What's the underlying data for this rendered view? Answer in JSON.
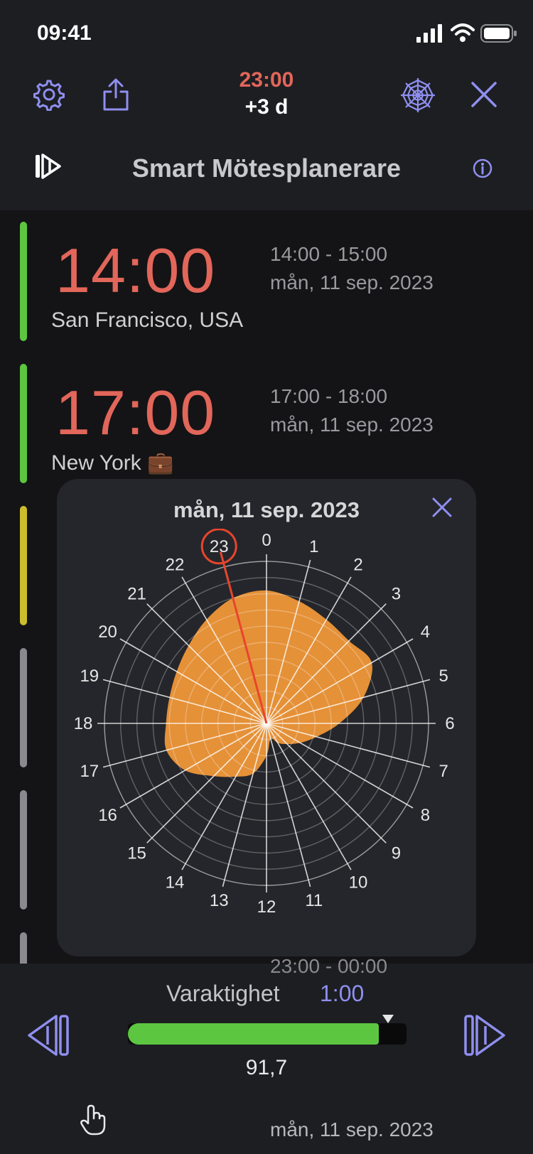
{
  "status": {
    "time": "09:41"
  },
  "toolbar": {
    "center_time": "23:00",
    "day_offset": "+3 d",
    "title": "Smart Mötesplanerare"
  },
  "cards": [
    {
      "time": "14:00",
      "city": "San Francisco, USA",
      "range": "14:00 - 15:00",
      "date": "mån, 11 sep. 2023",
      "bar_color": "#5dc640"
    },
    {
      "time": "17:00",
      "city": "New York 💼",
      "range": "17:00 - 18:00",
      "date": "mån, 11 sep. 2023",
      "bar_color": "#5dc640"
    }
  ],
  "partial_card": {
    "range": "23:00 - 00:00",
    "date": "mån, 11 sep. 2023"
  },
  "popup": {
    "date": "mån, 11 sep. 2023",
    "selected_hour": "23",
    "hours": [
      "0",
      "1",
      "2",
      "3",
      "4",
      "5",
      "6",
      "7",
      "8",
      "9",
      "10",
      "11",
      "12",
      "13",
      "14",
      "15",
      "16",
      "17",
      "18",
      "19",
      "20",
      "21",
      "22",
      "23"
    ],
    "chart_data": {
      "type": "polar-area",
      "categories": [
        "0",
        "1",
        "2",
        "3",
        "4",
        "5",
        "6",
        "7",
        "8",
        "9",
        "10",
        "11",
        "12",
        "13",
        "14",
        "15",
        "16",
        "17",
        "18",
        "19",
        "20",
        "21",
        "22",
        "23"
      ],
      "values": [
        0.82,
        0.78,
        0.74,
        0.72,
        0.75,
        0.62,
        0.45,
        0.32,
        0.24,
        0.18,
        0.14,
        0.1,
        0.2,
        0.32,
        0.38,
        0.46,
        0.58,
        0.64,
        0.62,
        0.62,
        0.64,
        0.68,
        0.74,
        0.8
      ],
      "rlim": [
        0,
        1
      ],
      "grid": true
    }
  },
  "bottom": {
    "duration_label": "Varaktighet",
    "duration_value": "1:00",
    "slider_fraction": 0.9,
    "score": "91,7"
  },
  "colors": {
    "accent": "#8f8ff0",
    "time_red": "#e2665a",
    "green": "#5dc640",
    "yellow": "#cbbd2c",
    "gray_bar": "#8a8a8e",
    "chart_fill": "#f59a3a"
  }
}
